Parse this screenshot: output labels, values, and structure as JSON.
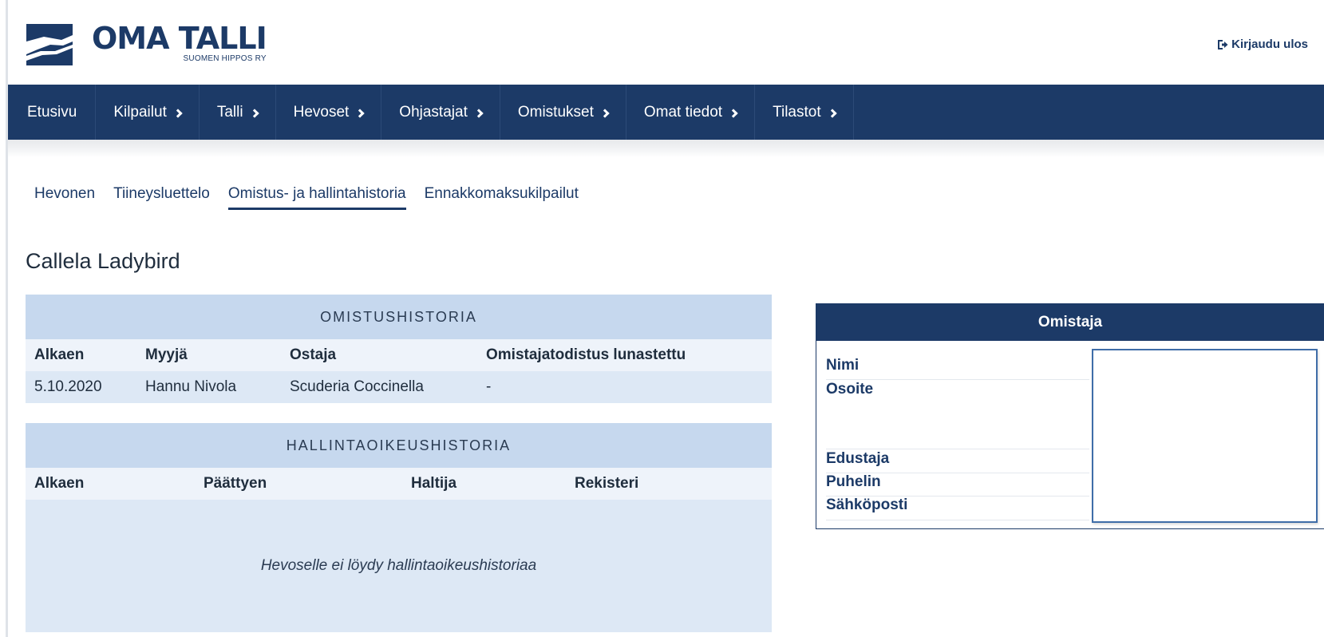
{
  "header": {
    "logo_title": "OMA TALLI",
    "logo_subtitle": "SUOMEN HIPPOS RY",
    "logout_label": "Kirjaudu ulos",
    "brand_color": "#1c3a67"
  },
  "nav": {
    "items": [
      {
        "label": "Etusivu",
        "has_chevron": false
      },
      {
        "label": "Kilpailut",
        "has_chevron": true
      },
      {
        "label": "Talli",
        "has_chevron": true
      },
      {
        "label": "Hevoset",
        "has_chevron": true
      },
      {
        "label": "Ohjastajat",
        "has_chevron": true
      },
      {
        "label": "Omistukset",
        "has_chevron": true
      },
      {
        "label": "Omat tiedot",
        "has_chevron": true
      },
      {
        "label": "Tilastot",
        "has_chevron": true
      }
    ]
  },
  "subtabs": {
    "items": [
      {
        "label": "Hevonen",
        "active": false
      },
      {
        "label": "Tiineysluettelo",
        "active": false
      },
      {
        "label": "Omistus- ja hallintahistoria",
        "active": true
      },
      {
        "label": "Ennakkomaksukilpailut",
        "active": false
      }
    ]
  },
  "horse": {
    "name": "Callela Ladybird"
  },
  "ownership_history": {
    "title": "OMISTUSHISTORIA",
    "columns": [
      "Alkaen",
      "Myyjä",
      "Ostaja",
      "Omistajatodistus lunastettu"
    ],
    "rows": [
      [
        "5.10.2020",
        "Hannu Nivola",
        "Scuderia Coccinella",
        "-"
      ]
    ]
  },
  "management_history": {
    "title": "HALLINTAOIKEUSHISTORIA",
    "columns": [
      "Alkaen",
      "Päättyen",
      "Haltija",
      "Rekisteri"
    ],
    "empty_message": "Hevoselle ei löydy hallintaoikeushistoriaa"
  },
  "owner_card": {
    "title": "Omistaja",
    "fields": [
      "Nimi",
      "Osoite",
      "Edustaja",
      "Puhelin",
      "Sähköposti"
    ]
  }
}
